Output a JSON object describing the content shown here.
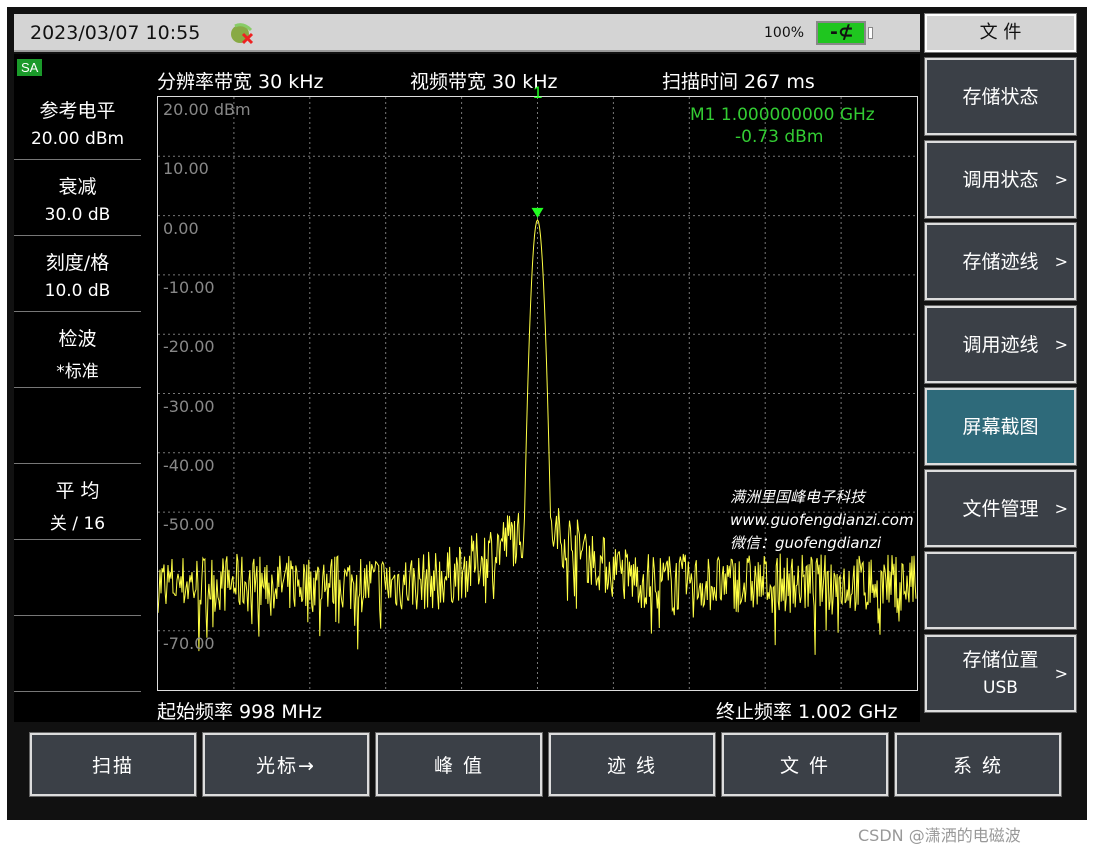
{
  "status_bar": {
    "datetime": "2023/03/07 10:55",
    "battery": "100%",
    "network_icon": "network-disconnected-icon",
    "battery_icon": "battery-plug-icon",
    "battery_color": "#1fc61f"
  },
  "mode_badge": "SA",
  "left_panel": [
    {
      "label": "参考电平",
      "value": "20.00 dBm"
    },
    {
      "label": "衰减",
      "value": "30.0 dB"
    },
    {
      "label": "刻度/格",
      "value": "10.0 dB"
    },
    {
      "label": "检波",
      "value": "*标准"
    },
    {
      "label": "",
      "value": ""
    },
    {
      "label": "平 均",
      "value": "关 / 16"
    },
    {
      "label": "",
      "value": ""
    },
    {
      "label": "",
      "value": ""
    }
  ],
  "header": {
    "rbw": "分辨率带宽  30 kHz",
    "vbw": "视频带宽  30 kHz",
    "sweep": "扫描时间  267 ms"
  },
  "footer": {
    "start": "起始频率  998 MHz",
    "stop": "终止频率  1.002 GHz"
  },
  "marker": {
    "number": "1",
    "line1": "M1   1.000000000 GHz",
    "line2": "-0.73 dBm"
  },
  "watermark": [
    "满洲里国峰电子科技",
    "www.guofengdianzi.com",
    "微信：guofengdianzi"
  ],
  "chart_data": {
    "type": "line",
    "y_tick_labels": [
      "20.00 dBm",
      "10.00",
      "0.00",
      "-10.00",
      "-20.00",
      "-30.00",
      "-40.00",
      "-50.00",
      "",
      "-70.00"
    ],
    "ylim": [
      -80,
      20
    ],
    "xlim_mhz": [
      998,
      1002
    ],
    "grid": true,
    "trace_color": "#ffff44",
    "noise_floor_dbm": -62,
    "sidelobe_level_dbm": -53,
    "peak": {
      "freq_mhz": 1000,
      "level_dbm": -0.73
    }
  },
  "right_panel": {
    "title": "文 件",
    "keys": [
      {
        "label": "存储状态",
        "arrow": "",
        "active": false
      },
      {
        "label": "调用状态",
        "arrow": ">",
        "active": false
      },
      {
        "label": "存储迹线",
        "arrow": ">",
        "active": false
      },
      {
        "label": "调用迹线",
        "arrow": ">",
        "active": false
      },
      {
        "label": "屏幕截图",
        "arrow": "",
        "active": true
      },
      {
        "label": "文件管理",
        "arrow": ">",
        "active": false
      },
      {
        "label": "",
        "arrow": "",
        "active": false
      },
      {
        "label": "存储位置",
        "sub": "USB",
        "arrow": ">",
        "active": false
      }
    ]
  },
  "bottom_buttons": [
    "扫描",
    "光标→",
    "峰 值",
    "迹 线",
    "文 件",
    "系 统"
  ],
  "page_watermark": "CSDN @潇洒的电磁波"
}
